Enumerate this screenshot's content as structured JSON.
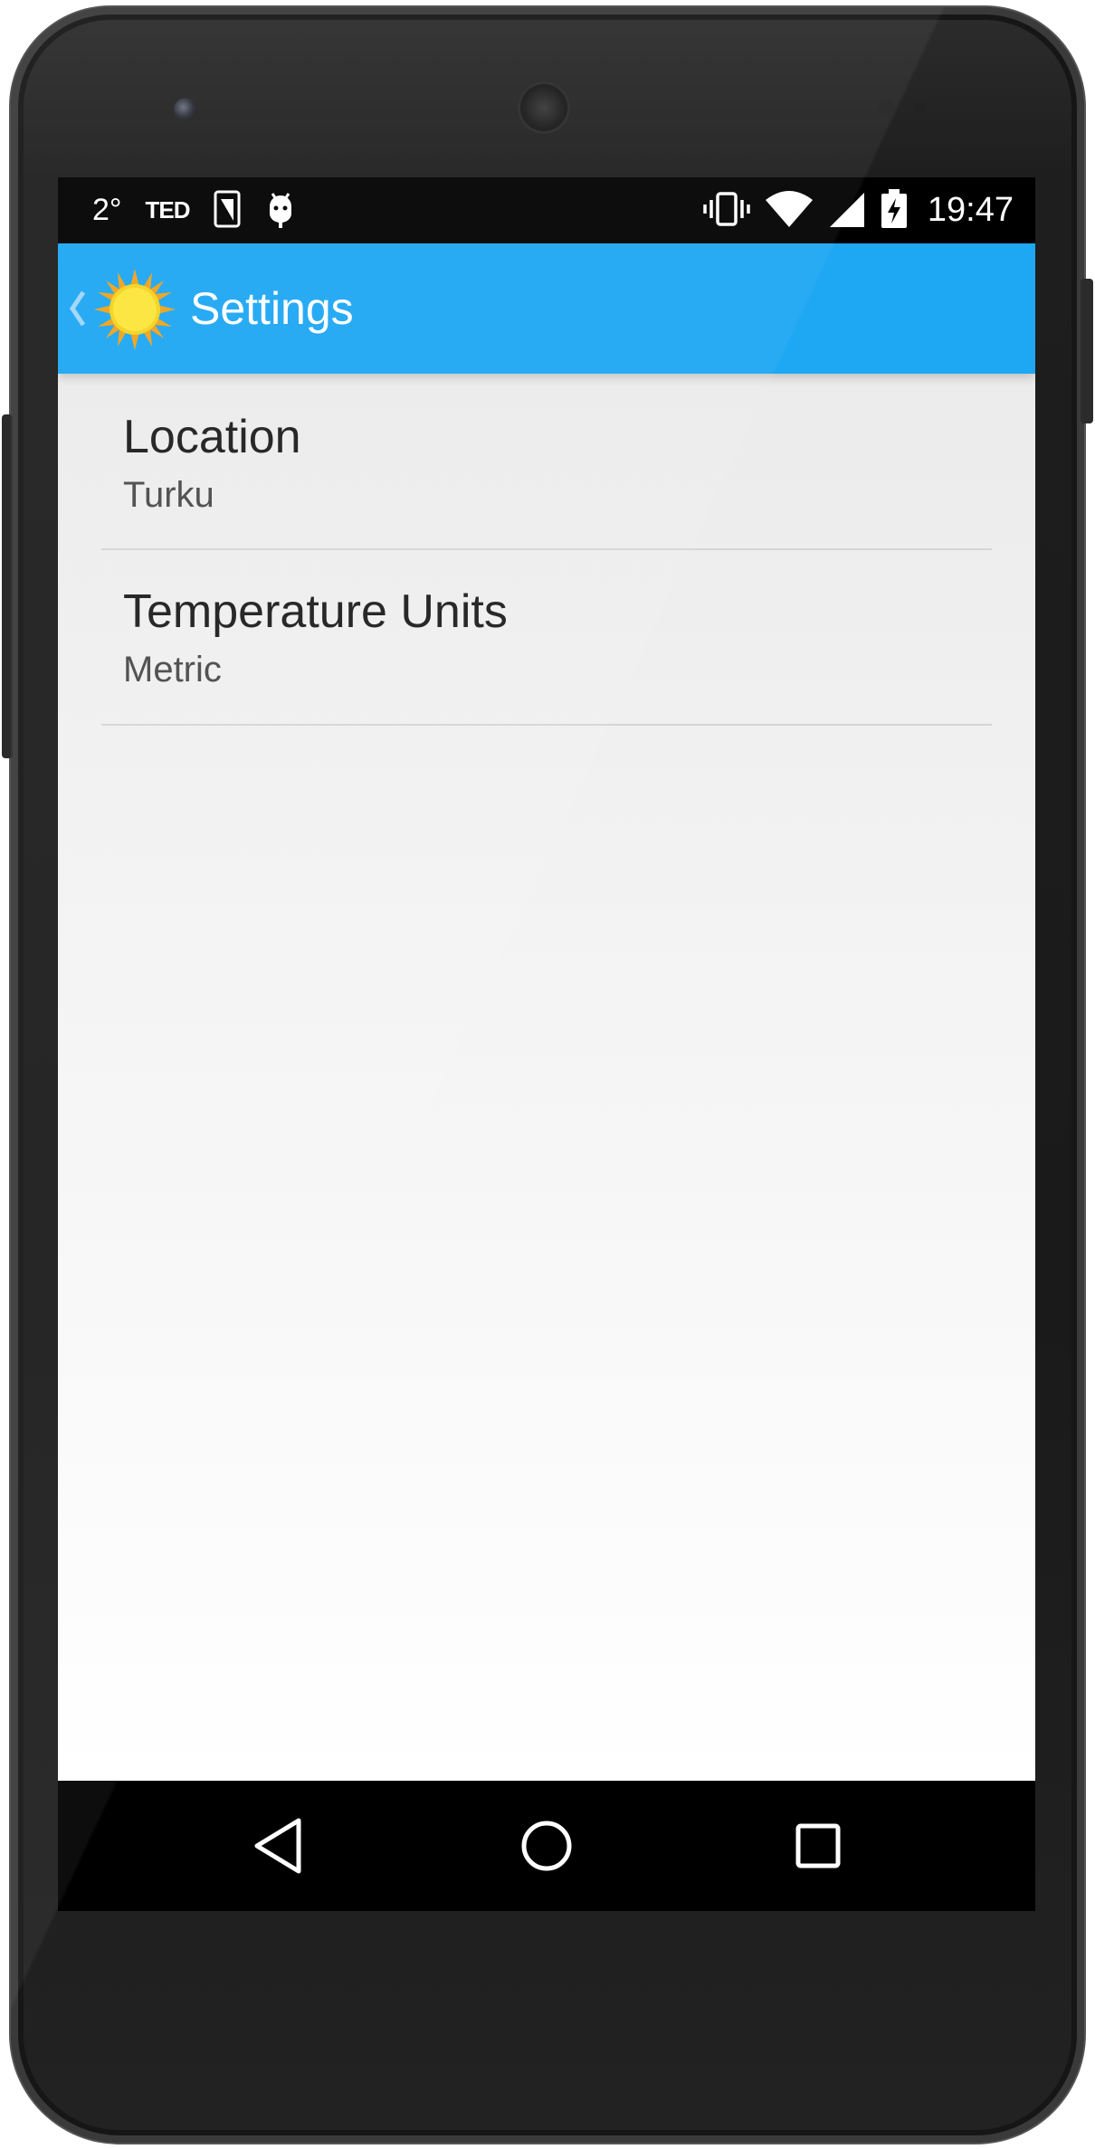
{
  "status_bar": {
    "temperature": "2°",
    "ted_label": "TED",
    "clock": "19:47",
    "icons": [
      "sim-card-icon",
      "android-debug-icon",
      "vibrate-icon",
      "wifi-icon",
      "cell-signal-icon",
      "battery-charging-icon"
    ]
  },
  "action_bar": {
    "title": "Settings",
    "up_icon": "chevron-left-icon",
    "logo_icon": "sun-icon",
    "background_color": "#1ea7f3"
  },
  "preferences": [
    {
      "title": "Location",
      "summary": "Turku"
    },
    {
      "title": "Temperature Units",
      "summary": "Metric"
    }
  ],
  "nav_bar": {
    "buttons": [
      "back-icon",
      "home-icon",
      "recents-icon"
    ]
  }
}
